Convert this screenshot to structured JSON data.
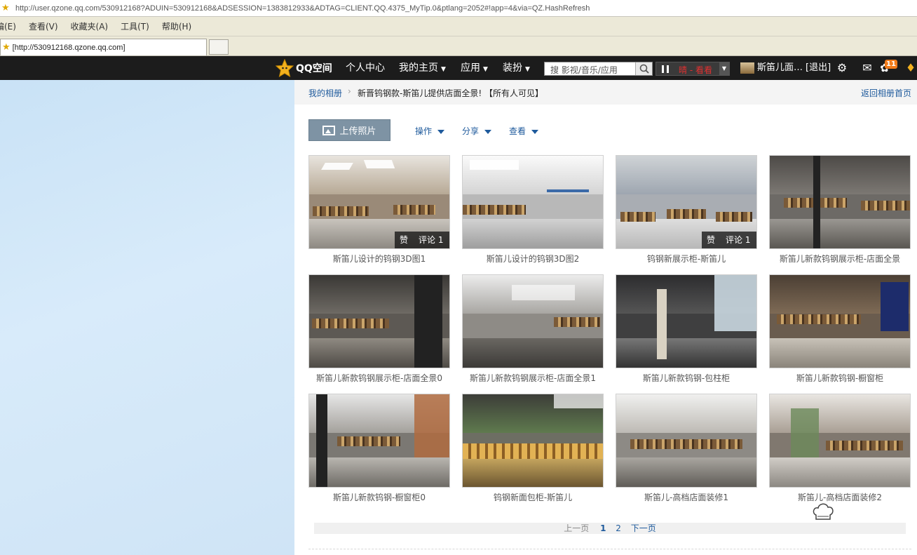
{
  "browser": {
    "url": "http://user.qzone.qq.com/530912168?ADUIN=530912168&ADSESSION=1383812933&ADTAG=CLIENT.QQ.4375_MyTip.0&ptlang=2052#!app=4&via=QZ.HashRefresh",
    "menu": [
      "编(E)",
      "查看(V)",
      "收藏夹(A)",
      "工具(T)",
      "帮助(H)"
    ],
    "tab_title": "[http://530912168.qzone.qq.com]"
  },
  "nav": {
    "logo": "QQ空间",
    "items": [
      "个人中心",
      "我的主页",
      "应用",
      "装扮"
    ],
    "search_placeholder": "搜 影视/音乐/应用",
    "music": "晴 - 看看",
    "username": "斯笛儿面…",
    "logout": "[退出]",
    "badge": "11",
    "icons": [
      "gear-icon",
      "mail-icon",
      "puzzle-icon",
      "diamond-icon"
    ]
  },
  "crumb": {
    "album": "我的相册",
    "title": "新晋钨钢款-斯笛儿提供店面全景! 【所有人可见】",
    "back": "返回相册首页"
  },
  "toolbar": {
    "upload": "上传照片",
    "ops": [
      "操作",
      "分享",
      "查看"
    ]
  },
  "photos": [
    {
      "caption": "斯笛儿设计的钨钢3D图1",
      "like": "赞",
      "comment": "评论 1"
    },
    {
      "caption": "斯笛儿设计的钨钢3D图2"
    },
    {
      "caption": "钨钢新展示柜-斯笛儿",
      "like": "赞",
      "comment": "评论 1"
    },
    {
      "caption": "斯笛儿新款钨钢展示柜-店面全景"
    },
    {
      "caption": "斯笛儿新款钨钢展示柜-店面全景0"
    },
    {
      "caption": "斯笛儿新款钨钢展示柜-店面全景1"
    },
    {
      "caption": "斯笛儿新款钨钢-包柱柜"
    },
    {
      "caption": "斯笛儿新款钨钢-橱窗柜"
    },
    {
      "caption": "斯笛儿新款钨钢-橱窗柜0"
    },
    {
      "caption": "钨钢新面包柜-斯笛儿"
    },
    {
      "caption": "斯笛儿-高档店面装修1"
    },
    {
      "caption": "斯笛儿-高档店面装修2"
    }
  ],
  "pager": {
    "prev": "上一页",
    "p1": "1",
    "p2": "2",
    "next": "下一页"
  }
}
